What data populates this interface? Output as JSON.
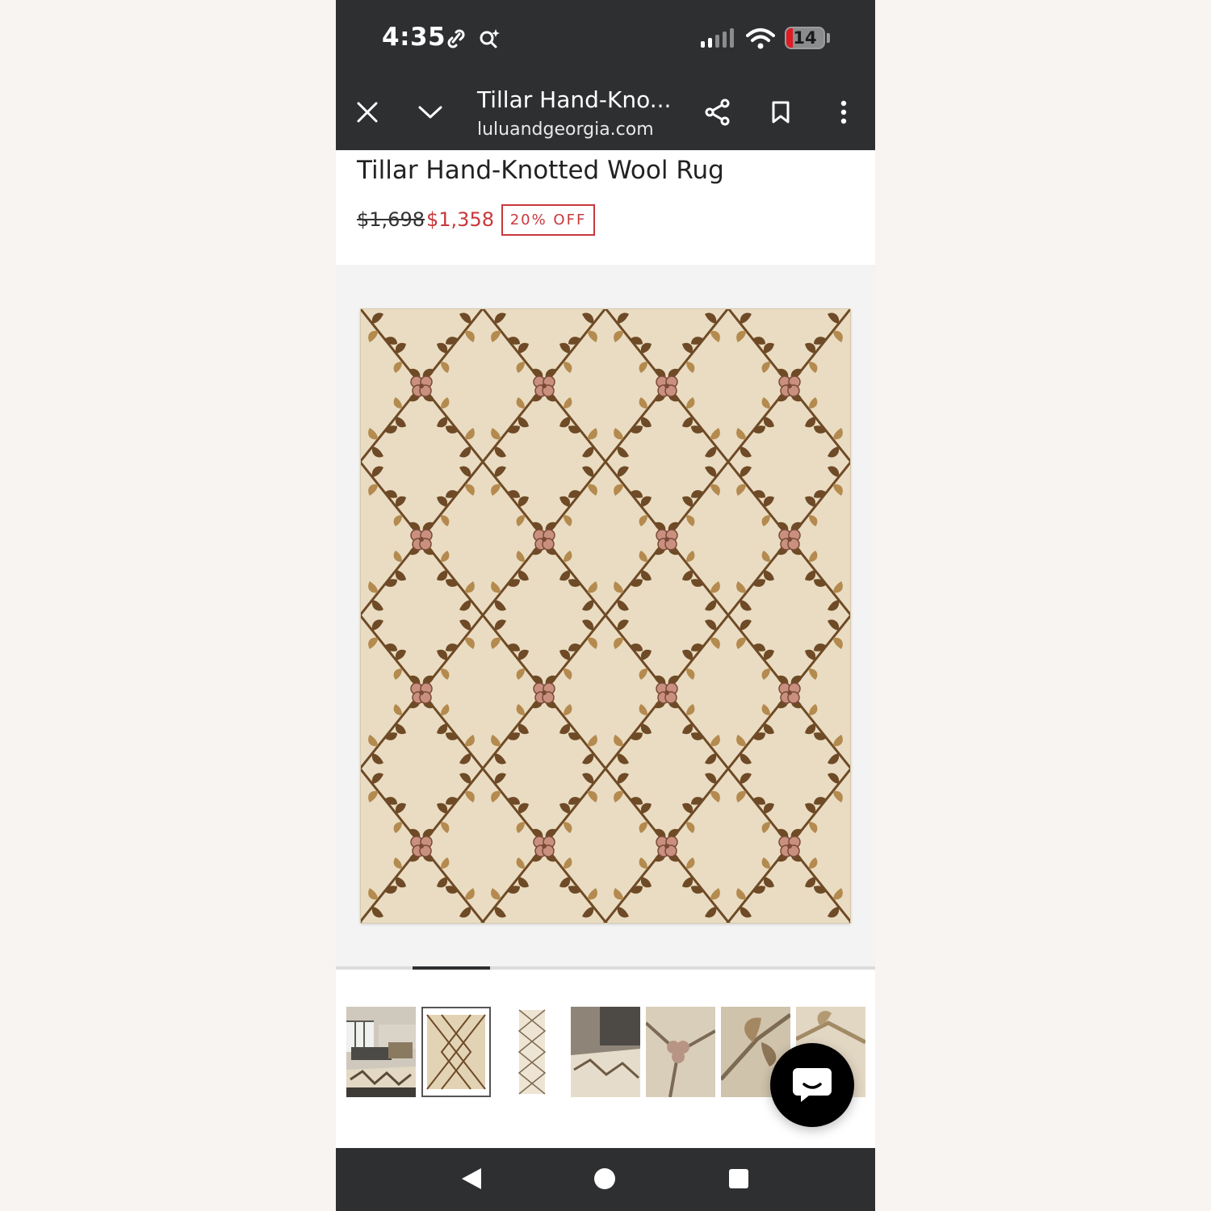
{
  "status_bar": {
    "time": "4:35",
    "battery_level": "14",
    "icons": [
      "link-icon",
      "search-sparkle-icon",
      "signal-icon",
      "wifi-icon",
      "battery-icon"
    ]
  },
  "browser": {
    "title": "Tillar Hand-Kno...",
    "url": "luluandgeorgia.com",
    "buttons": [
      "close-icon",
      "chevron-down-icon",
      "share-icon",
      "bookmark-icon",
      "more-vert-icon"
    ]
  },
  "product": {
    "title": "Tillar Hand-Knotted Wool Rug",
    "original_price": "$1,698",
    "sale_price": "$1,358",
    "discount_badge": "20% OFF"
  },
  "gallery": {
    "thumbnail_count": 7,
    "selected_index": 1,
    "progress_position": "2 of 7"
  },
  "colors": {
    "sale_red": "#c8383b",
    "chrome_dark": "#2d2f31",
    "rug_background": "#e9dcc2",
    "leaf_brown": "#6e4a26",
    "leaf_tan": "#b48a4e",
    "flower_pink": "#c9907f"
  },
  "nav": {
    "buttons": [
      "back-icon",
      "home-icon",
      "recents-icon"
    ]
  }
}
